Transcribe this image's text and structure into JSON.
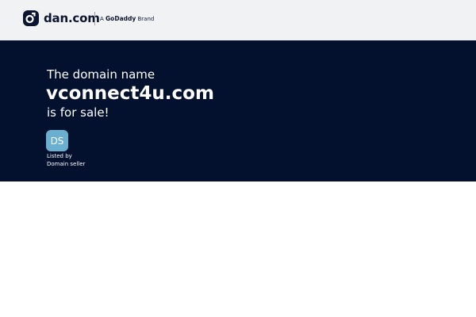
{
  "header": {
    "logo_text": "dan.com",
    "brand_prefix": "A",
    "brand_name": "GoDaddy",
    "brand_suffix": "Brand"
  },
  "hero": {
    "intro": "The domain name",
    "domain": "vconnect4u.com",
    "status": "is for sale!"
  },
  "seller": {
    "avatar_initials": "DS",
    "listed_by": "Listed by",
    "name": "Domain seller"
  },
  "colors": {
    "header_bg": "#f1f2f4",
    "hero_bg": "#03112e",
    "avatar_bg": "#6aaed0",
    "brand_dark": "#0b1530"
  },
  "icons": {
    "logo": "dan-logo-icon"
  }
}
